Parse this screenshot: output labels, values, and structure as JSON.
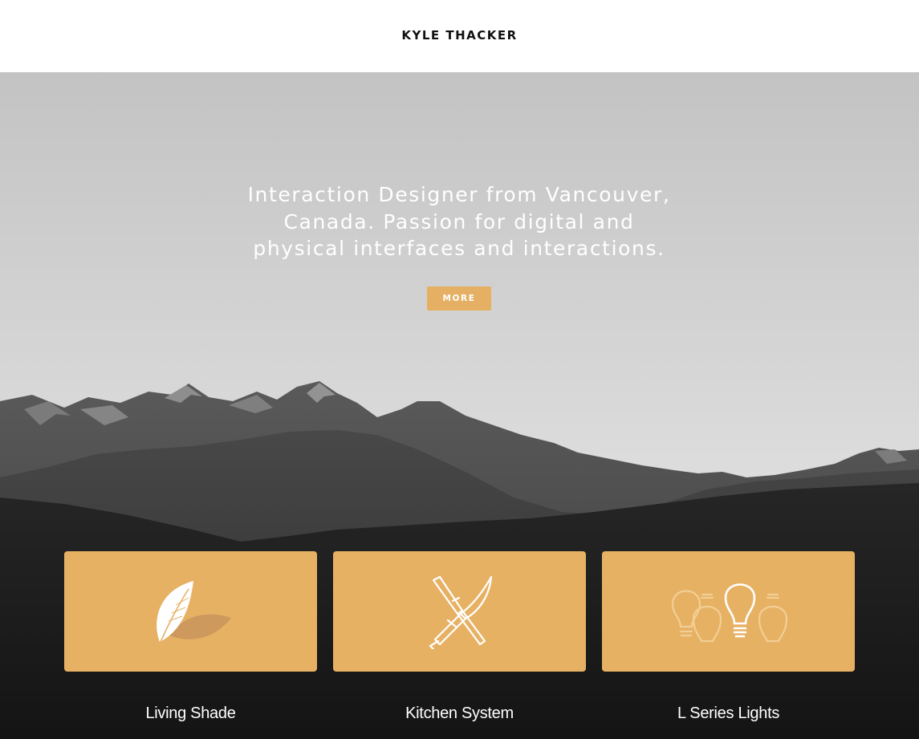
{
  "header": {
    "title": "KYLE THACKER"
  },
  "hero": {
    "tagline_lines": [
      "Interaction Designer from Vancouver,",
      "Canada. Passion for digital and",
      "physical interfaces and interactions."
    ],
    "more_label": "MORE"
  },
  "projects": [
    {
      "label": "Living Shade",
      "icon": "leaf-icon"
    },
    {
      "label": "Kitchen System",
      "icon": "crossed-knives-icon"
    },
    {
      "label": "L Series Lights",
      "icon": "light-bulbs-icon"
    }
  ],
  "colors": {
    "accent": "#e7b164",
    "header_bg": "#ffffff",
    "title_text": "#111111"
  }
}
